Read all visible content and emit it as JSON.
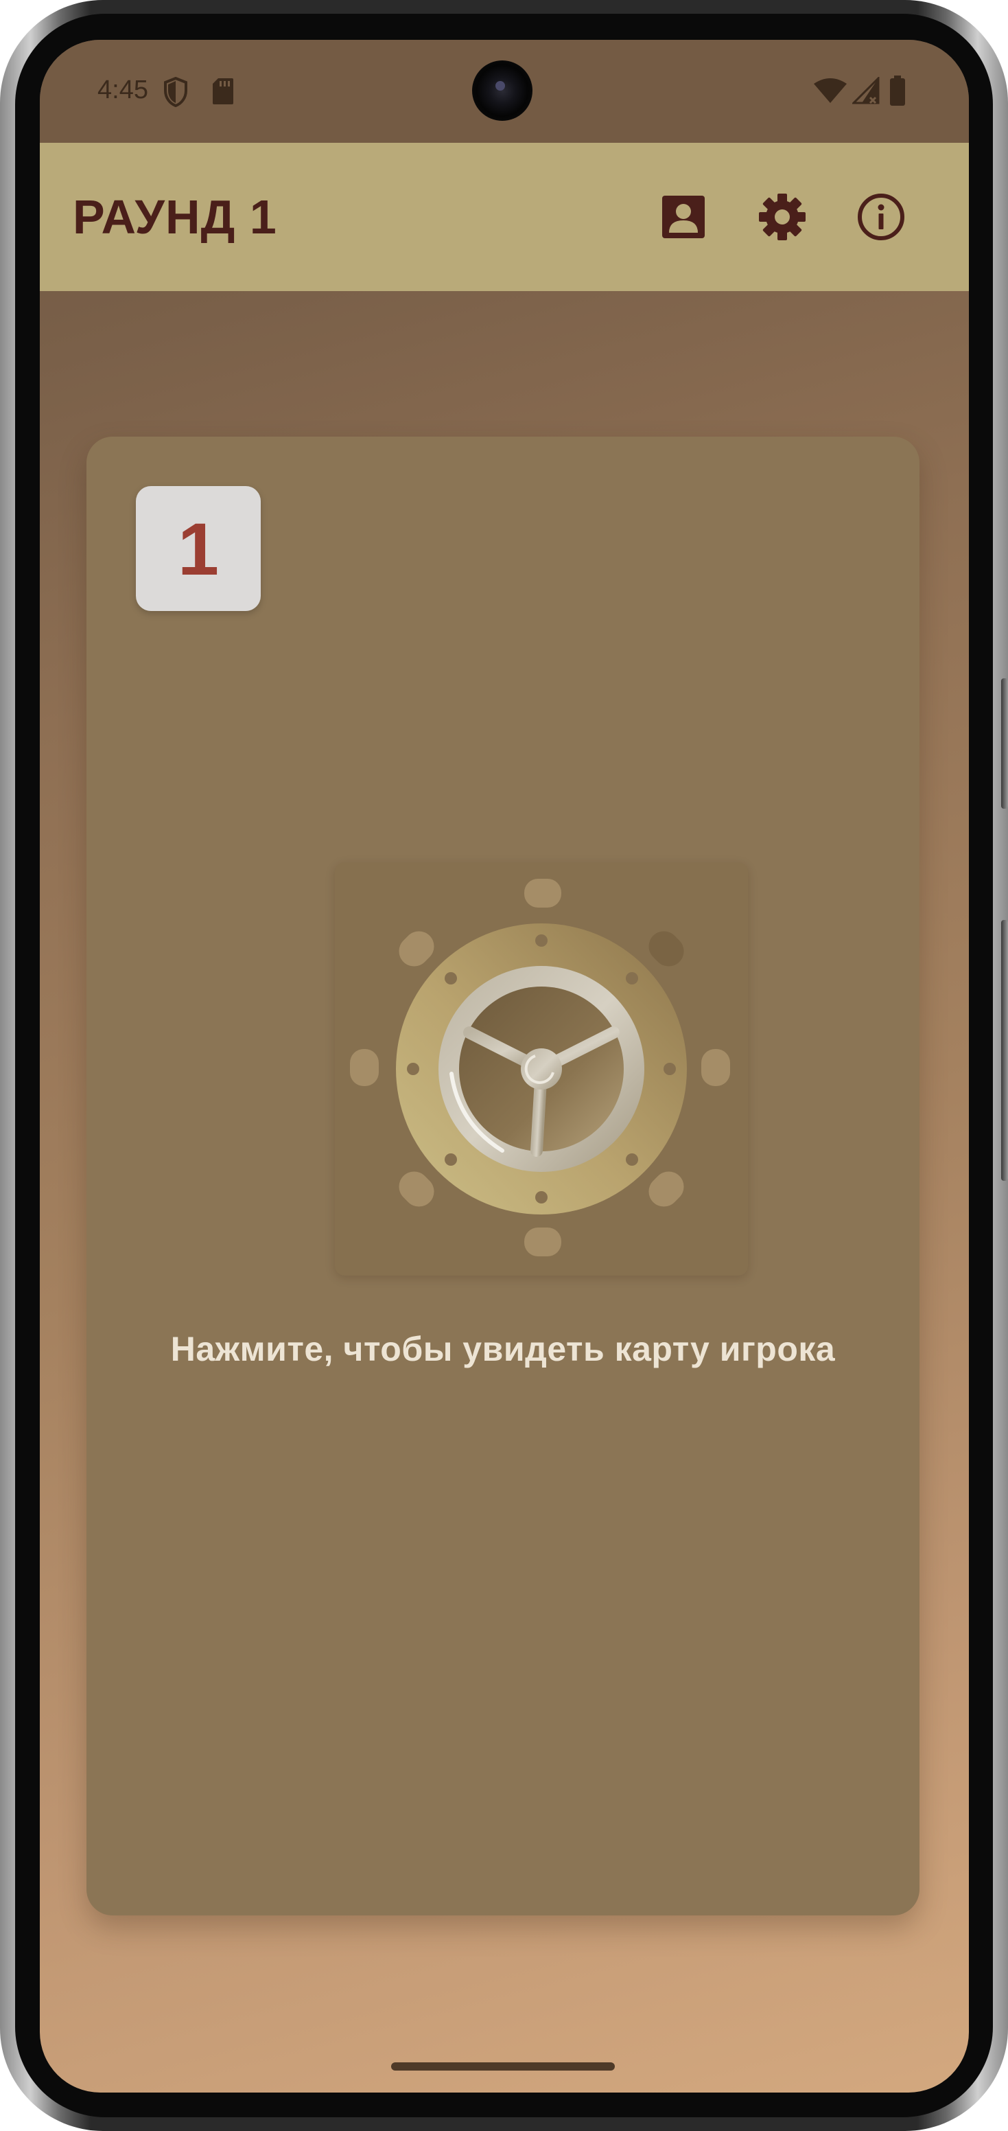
{
  "status_bar": {
    "time": "4:45"
  },
  "app_bar": {
    "title": "РАУНД 1",
    "actions": [
      {
        "icon": "player-card-icon"
      },
      {
        "icon": "gear-icon"
      },
      {
        "icon": "info-icon"
      }
    ]
  },
  "card": {
    "round_number": "1",
    "hint": "Нажмите, чтобы увидеть карту игрока"
  },
  "colors": {
    "app_bar": "#b9aa79",
    "title": "#4a1f1a",
    "card": "#8b7555",
    "badge_number": "#9b3e32",
    "hint": "#ede4d4"
  }
}
